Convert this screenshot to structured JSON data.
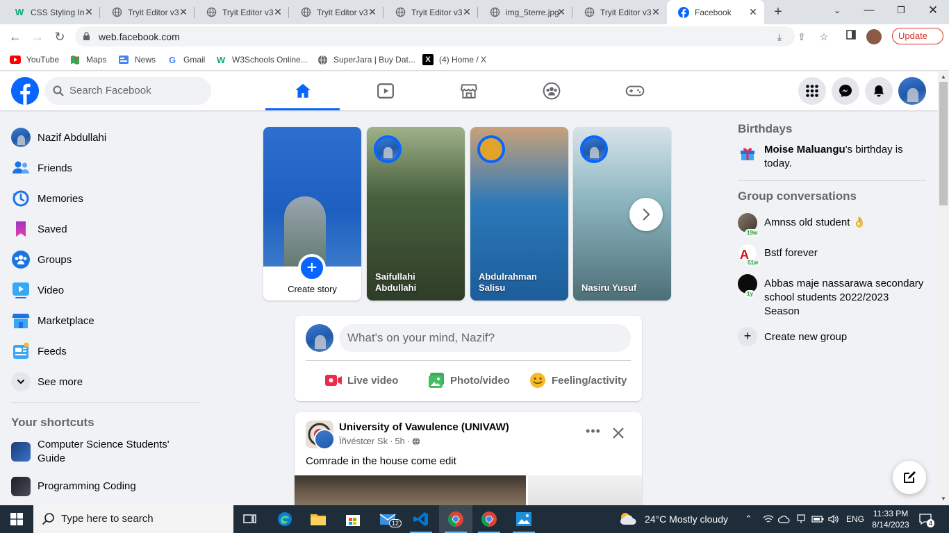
{
  "browser": {
    "tabs": [
      {
        "title": "CSS Styling In",
        "icon": "w3schools-icon"
      },
      {
        "title": "Tryit Editor v3",
        "icon": "globe-icon"
      },
      {
        "title": "Tryit Editor v3",
        "icon": "globe-icon"
      },
      {
        "title": "Tryit Editor v3",
        "icon": "globe-icon"
      },
      {
        "title": "Tryit Editor v3",
        "icon": "globe-icon"
      },
      {
        "title": "img_5terre.jpg",
        "icon": "globe-icon"
      },
      {
        "title": "Tryit Editor v3",
        "icon": "globe-icon"
      },
      {
        "title": "Facebook",
        "icon": "facebook-icon",
        "active": true
      }
    ],
    "url": "web.facebook.com",
    "update_label": "Update",
    "bookmarks": [
      {
        "label": "YouTube",
        "icon": "youtube-icon"
      },
      {
        "label": "Maps",
        "icon": "maps-icon"
      },
      {
        "label": "News",
        "icon": "news-icon"
      },
      {
        "label": "Gmail",
        "icon": "google-icon"
      },
      {
        "label": "W3Schools Online...",
        "icon": "w3schools-icon"
      },
      {
        "label": "SuperJara | Buy Dat...",
        "icon": "globe-icon"
      },
      {
        "label": "(4) Home / X",
        "icon": "x-icon"
      }
    ]
  },
  "fb": {
    "search_placeholder": "Search Facebook",
    "user": "Nazif Abdullahi",
    "sidebar": [
      {
        "label": "Friends",
        "icon": "friends-icon"
      },
      {
        "label": "Memories",
        "icon": "memories-icon"
      },
      {
        "label": "Saved",
        "icon": "saved-icon"
      },
      {
        "label": "Groups",
        "icon": "groups-icon"
      },
      {
        "label": "Video",
        "icon": "video-icon"
      },
      {
        "label": "Marketplace",
        "icon": "marketplace-icon"
      },
      {
        "label": "Feeds",
        "icon": "feeds-icon"
      },
      {
        "label": "See more",
        "icon": "chevron-down-icon"
      }
    ],
    "shortcuts_heading": "Your shortcuts",
    "shortcuts": [
      {
        "label": "Computer Science Students' Guide"
      },
      {
        "label": "Programming Coding"
      }
    ],
    "stories": {
      "create_label": "Create story",
      "items": [
        {
          "name": "Saifullahi Abdullahi"
        },
        {
          "name": "Abdulrahman Salisu"
        },
        {
          "name": "Nasiru Yusuf"
        }
      ]
    },
    "composer": {
      "placeholder": "What's on your mind, Nazif?",
      "actions": [
        {
          "label": "Live video",
          "color": "#f02849"
        },
        {
          "label": "Photo/video",
          "color": "#45bd62"
        },
        {
          "label": "Feeling/activity",
          "color": "#f7b928"
        }
      ]
    },
    "post": {
      "group": "University of Vawulence (UNIVAW)",
      "author": "Ïñvéstœr Sk",
      "time": "5h",
      "text": "Comrade in the house come edit"
    },
    "right": {
      "birthdays_heading": "Birthdays",
      "birthday_name": "Moise Maluangu",
      "birthday_text": "'s birthday is today.",
      "groups_heading": "Group conversations",
      "groups": [
        {
          "name": "Amnss old student 👌",
          "badge": "19w"
        },
        {
          "name": "Bstf forever",
          "badge": "51w"
        },
        {
          "name": "Abbas maje nassarawa secondary school students 2022/2023 Season",
          "badge": "1y"
        }
      ],
      "create_group": "Create new group"
    },
    "accent": "#0866ff"
  },
  "taskbar": {
    "search_placeholder": "Type here to search",
    "weather": "24°C  Mostly cloudy",
    "lang": "ENG",
    "time": "11:33 PM",
    "date": "8/14/2023",
    "mail_badge": "12",
    "notif_badge": "4"
  }
}
